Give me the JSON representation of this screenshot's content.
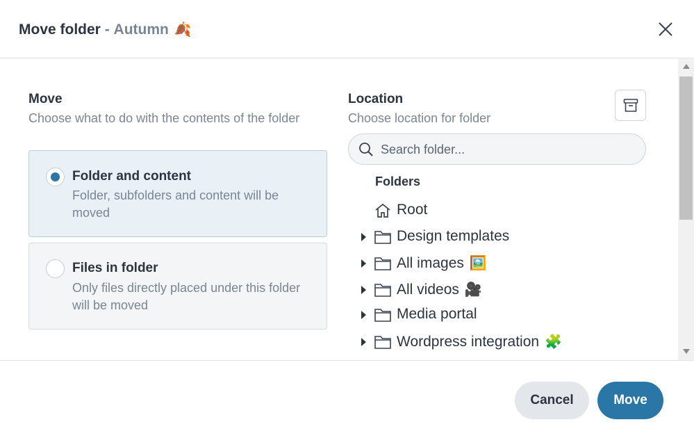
{
  "dialog": {
    "title": "Move folder",
    "title_separator": " - ",
    "folder_name": "Autumn",
    "folder_emoji": "🍂"
  },
  "move_section": {
    "label": "Move",
    "description": "Choose what to do with the contents of the folder",
    "options": [
      {
        "title": "Folder and content",
        "description": "Folder, subfolders and content will be moved",
        "selected": true
      },
      {
        "title": "Files in folder",
        "description": "Only files directly placed under this folder will be moved",
        "selected": false
      }
    ]
  },
  "location_section": {
    "label": "Location",
    "description": "Choose location for folder",
    "search_placeholder": "Search folder...",
    "folders_heading": "Folders",
    "tree": [
      {
        "label": "Root",
        "icon": "home-icon",
        "expandable": false,
        "emoji": ""
      },
      {
        "label": "Design templates",
        "icon": "folder-icon",
        "expandable": true,
        "emoji": ""
      },
      {
        "label": "All images",
        "icon": "folder-icon",
        "expandable": true,
        "emoji": "🖼️"
      },
      {
        "label": "All videos",
        "icon": "folder-icon",
        "expandable": true,
        "emoji": "🎥"
      },
      {
        "label": "Media portal",
        "icon": "folder-icon",
        "expandable": true,
        "emoji": ""
      },
      {
        "label": "Wordpress integration",
        "icon": "folder-icon",
        "expandable": true,
        "emoji": "🧩"
      }
    ]
  },
  "footer": {
    "cancel_label": "Cancel",
    "move_label": "Move"
  },
  "colors": {
    "accent": "#2a76a6",
    "selected_option_bg": "#e9f1f6",
    "muted_text": "#7a8594"
  }
}
